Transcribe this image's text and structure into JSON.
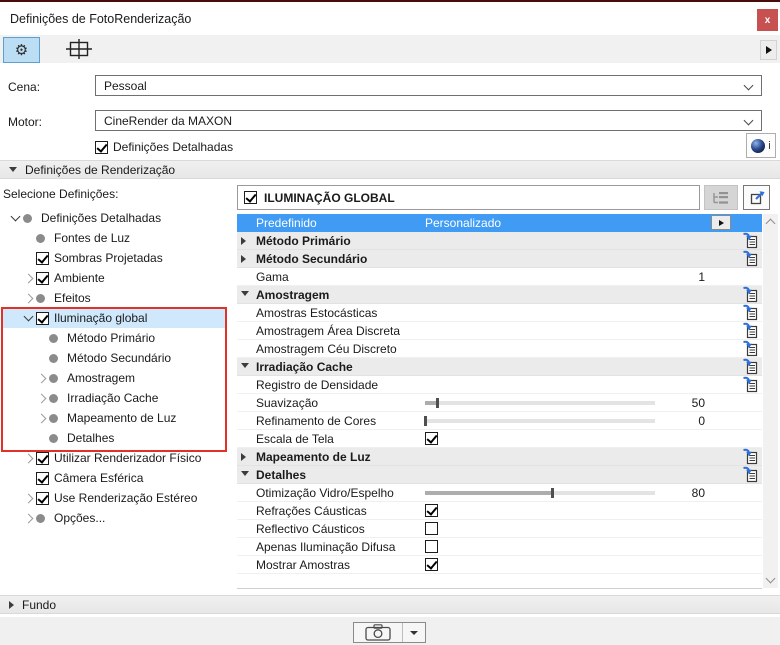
{
  "window": {
    "title": "Definições de FotoRenderização",
    "close_glyph": "x"
  },
  "icons": {
    "gear-icon": "⚙",
    "panel-layout-icon": "window with crosshair",
    "forward-arrow-icon": "black right triangle",
    "close-icon": "x on red",
    "cinema4d-info-icon": "dark blue sphere + i",
    "link-icon": "page with blue curved arrow",
    "tree-list-icon": "gray hierarchy list",
    "export-icon": "page with blue up-right arrow",
    "camera-icon": "camera outline",
    "dropdown-arrow-icon": "small down triangle"
  },
  "colors": {
    "accent_selection": "#3f9bf3",
    "tree_selection": "#cfe8fb",
    "annotation_red": "#e23227",
    "close_red": "#c75050",
    "link_blue": "#2e6fd8",
    "toolbar_active_bg": "#bcdef4"
  },
  "form": {
    "scene_label": "Cena:",
    "scene_value": "Pessoal",
    "engine_label": "Motor:",
    "engine_value": "CineRender da MAXON",
    "detailed_label": "Definições Detalhadas",
    "detailed_checked": true,
    "info_label": "i"
  },
  "render_section": {
    "title": "Definições de Renderização"
  },
  "tree": {
    "label": "Selecione Definições:",
    "items": [
      {
        "label": "Definições Detalhadas",
        "level": 0,
        "expand": "open",
        "marker": "dot"
      },
      {
        "label": "Fontes de Luz",
        "level": 1,
        "expand": "none",
        "marker": "dot"
      },
      {
        "label": "Sombras Projetadas",
        "level": 1,
        "expand": "none",
        "marker": "checked"
      },
      {
        "label": "Ambiente",
        "level": 1,
        "expand": "closed",
        "marker": "checked"
      },
      {
        "label": "Efeitos",
        "level": 1,
        "expand": "closed",
        "marker": "dot"
      },
      {
        "label": "Iluminação global",
        "level": 1,
        "expand": "open",
        "marker": "checked",
        "selected": true
      },
      {
        "label": "Método Primário",
        "level": 2,
        "expand": "none",
        "marker": "dot"
      },
      {
        "label": "Método Secundário",
        "level": 2,
        "expand": "none",
        "marker": "dot"
      },
      {
        "label": "Amostragem",
        "level": 2,
        "expand": "closed",
        "marker": "dot"
      },
      {
        "label": "Irradiação Cache",
        "level": 2,
        "expand": "closed",
        "marker": "dot"
      },
      {
        "label": "Mapeamento de Luz",
        "level": 2,
        "expand": "closed",
        "marker": "dot"
      },
      {
        "label": "Detalhes",
        "level": 2,
        "expand": "none",
        "marker": "dot"
      },
      {
        "label": "Utilizar Renderizador Físico",
        "level": 1,
        "expand": "closed",
        "marker": "checked"
      },
      {
        "label": "Câmera Esférica",
        "level": 1,
        "expand": "none",
        "marker": "checked"
      },
      {
        "label": "Use Renderização Estéreo",
        "level": 1,
        "expand": "closed",
        "marker": "checked"
      },
      {
        "label": "Opções...",
        "level": 1,
        "expand": "closed",
        "marker": "dot"
      }
    ]
  },
  "panel": {
    "header": {
      "title": "ILUMINAÇÃO GLOBAL",
      "checked": true
    },
    "rows": [
      {
        "type": "preset",
        "left": "Predefinido",
        "right": "Personalizado"
      },
      {
        "type": "section",
        "label": "Método Primário",
        "expand": "closed",
        "link": true
      },
      {
        "type": "section",
        "label": "Método Secundário",
        "expand": "closed",
        "link": true
      },
      {
        "type": "value",
        "label": "Gama",
        "value": "1"
      },
      {
        "type": "section",
        "label": "Amostragem",
        "expand": "open",
        "link": true
      },
      {
        "type": "item",
        "label": "Amostras Estocásticas",
        "link": true
      },
      {
        "type": "item",
        "label": "Amostragem Área Discreta",
        "link": true
      },
      {
        "type": "item",
        "label": "Amostragem Céu Discreto",
        "link": true
      },
      {
        "type": "section",
        "label": "Irradiação Cache",
        "expand": "open",
        "link": true
      },
      {
        "type": "item",
        "label": "Registro de Densidade",
        "link": true
      },
      {
        "type": "slider",
        "label": "Suavização",
        "value": "50",
        "percent": 5
      },
      {
        "type": "slider",
        "label": "Refinamento de Cores",
        "value": "0",
        "percent": 0
      },
      {
        "type": "check",
        "label": "Escala de Tela",
        "checked": true
      },
      {
        "type": "section",
        "label": "Mapeamento de Luz",
        "expand": "closed",
        "link": true
      },
      {
        "type": "section",
        "label": "Detalhes",
        "expand": "open",
        "link": true
      },
      {
        "type": "slider",
        "label": "Otimização Vidro/Espelho",
        "value": "80",
        "percent": 55
      },
      {
        "type": "check",
        "label": "Refrações Cáusticas",
        "checked": true
      },
      {
        "type": "check",
        "label": "Reflectivo Cáusticos",
        "checked": false
      },
      {
        "type": "check",
        "label": "Apenas Iluminação Difusa",
        "checked": false
      },
      {
        "type": "check",
        "label": "Mostrar Amostras",
        "checked": true
      }
    ]
  },
  "fundo": {
    "title": "Fundo"
  }
}
